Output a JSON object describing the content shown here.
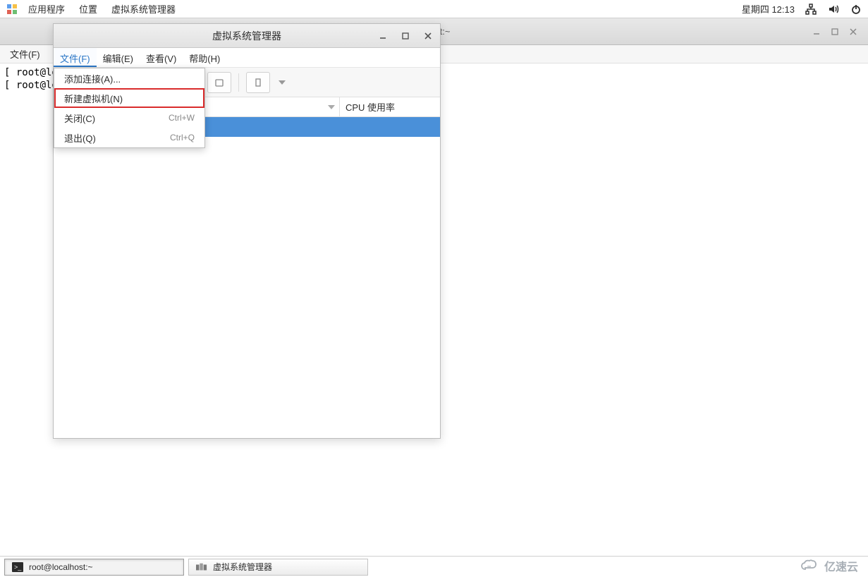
{
  "panel": {
    "apps": "应用程序",
    "places": "位置",
    "vm_mgr": "虚拟系统管理器",
    "clock": "星期四 12:13"
  },
  "terminal": {
    "title": "alhost:~",
    "menu_file": "文件(F)",
    "line1": "[ root@lo",
    "line2": "[ root@lo"
  },
  "vm": {
    "title": "虚拟系统管理器",
    "menu": {
      "file": "文件(F)",
      "edit": "编辑(E)",
      "view": "查看(V)",
      "help": "帮助(H)"
    },
    "columns": {
      "cpu": "CPU 使用率"
    }
  },
  "dropdown": {
    "add_connection": "添加连接(A)...",
    "new_vm": "新建虚拟机(N)",
    "shutdown": "关闭(C)",
    "shutdown_accel": "Ctrl+W",
    "quit": "退出(Q)",
    "quit_accel": "Ctrl+Q"
  },
  "taskbar": {
    "terminal": "root@localhost:~",
    "vm": "虚拟系统管理器"
  },
  "watermark": "亿速云"
}
